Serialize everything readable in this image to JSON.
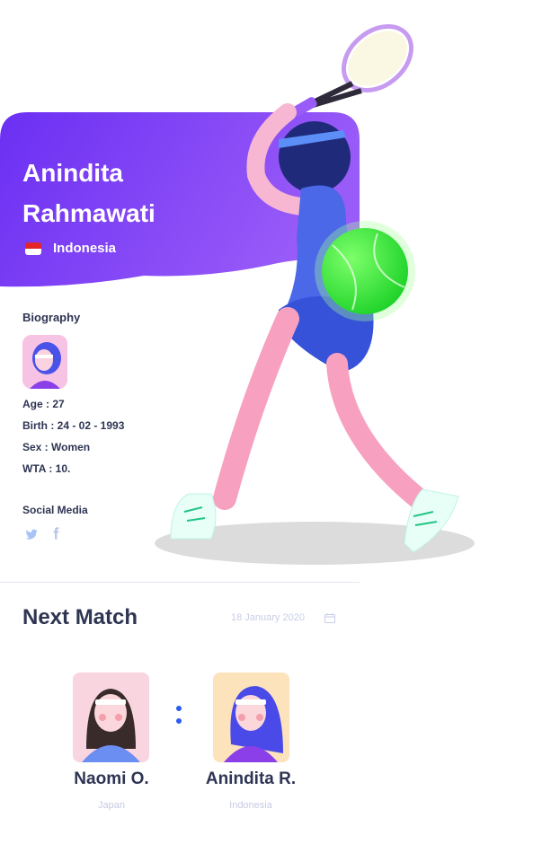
{
  "player": {
    "first_name": "Anindita",
    "last_name": "Rahmawati",
    "country": "Indonesia"
  },
  "biography": {
    "title": "Biography",
    "age": "Age : 27",
    "birth": "Birth : 24 - 02 - 1993",
    "sex": "Sex : Women",
    "wta": "WTA : 10."
  },
  "social": {
    "title": "Social Media",
    "icons": [
      "twitter-icon",
      "facebook-icon"
    ]
  },
  "next_match": {
    "title": "Next Match",
    "date": "18 January 2020",
    "players": [
      {
        "name": "Naomi O.",
        "country": "Japan"
      },
      {
        "name": "Anindita R.",
        "country": "Indonesia"
      }
    ]
  },
  "colors": {
    "hero_gradient_start": "#6b2ff3",
    "hero_gradient_end": "#9d5cf7",
    "text_dark": "#2e3553",
    "accent_blue": "#2a5cf6",
    "ball_green": "#3df23d"
  }
}
